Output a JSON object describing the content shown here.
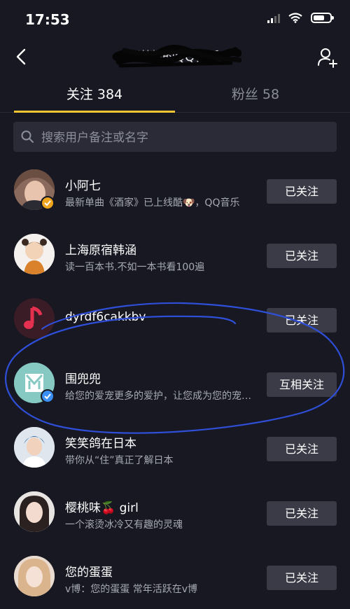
{
  "status_bar": {
    "time": "17:53",
    "battery_level": 0.7
  },
  "header": {
    "title": "谢菲的QQ音乐"
  },
  "tabs": [
    {
      "label": "关注 384",
      "active": true
    },
    {
      "label": "粉丝 58",
      "active": false
    }
  ],
  "search": {
    "placeholder": "搜索用户备注或名字",
    "value": ""
  },
  "users": [
    {
      "name": "小阿七",
      "desc": "最新单曲《酒家》已上线酷🐶，QQ音乐",
      "button": "已关注"
    },
    {
      "name": "上海原宿韩涵",
      "desc": "读一百本书.不如一本书看100遍",
      "button": "已关注"
    },
    {
      "name": "dyrdf6cakkbv",
      "desc": "",
      "button": "已关注"
    },
    {
      "name": "围兜兜",
      "desc": "给您的爱宠更多的爱护，让您成为您的宠物最好的朋友",
      "button": "互相关注"
    },
    {
      "name": "笑笑鸽在日本",
      "desc": "带你从“住”真正了解日本",
      "button": "已关注"
    },
    {
      "name": "樱桃味🍒 girl",
      "desc": "一个滚烫冰冷又有趣的灵魂",
      "button": "已关注"
    },
    {
      "name": "您的蛋蛋",
      "desc": "v博：您的蛋蛋 常年活跃在v博",
      "button": "已关注"
    }
  ],
  "colors": {
    "background": "#171822",
    "tab_indicator": "#f5c432",
    "button_bg": "#3a3b46",
    "annotation_blue": "#2f4fd8"
  }
}
